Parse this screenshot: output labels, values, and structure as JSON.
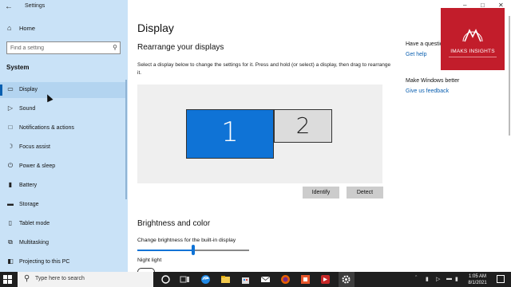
{
  "window": {
    "app_title": "Settings"
  },
  "sidebar": {
    "home_label": "Home",
    "search_placeholder": "Find a setting",
    "section_label": "System",
    "items": [
      {
        "label": "Display",
        "icon": "monitor-icon",
        "selected": true
      },
      {
        "label": "Sound",
        "icon": "speaker-icon"
      },
      {
        "label": "Notifications & actions",
        "icon": "notification-icon"
      },
      {
        "label": "Focus assist",
        "icon": "moon-icon"
      },
      {
        "label": "Power & sleep",
        "icon": "power-icon"
      },
      {
        "label": "Battery",
        "icon": "battery-icon"
      },
      {
        "label": "Storage",
        "icon": "storage-icon"
      },
      {
        "label": "Tablet mode",
        "icon": "tablet-icon"
      },
      {
        "label": "Multitasking",
        "icon": "multitasking-icon"
      },
      {
        "label": "Projecting to this PC",
        "icon": "projecting-icon"
      }
    ]
  },
  "main": {
    "page_title": "Display",
    "section_title": "Rearrange your displays",
    "description": "Select a display below to change the settings for it. Press and hold (or select) a display, then drag to rearrange it.",
    "monitors": [
      {
        "number": "1",
        "selected": true
      },
      {
        "number": "2",
        "selected": false
      }
    ],
    "identify_label": "Identify",
    "detect_label": "Detect",
    "brightness_title": "Brightness and color",
    "brightness_label": "Change brightness for the built-in display",
    "brightness_value_pct": 50,
    "night_light_label": "Night light"
  },
  "right_panel": {
    "question": "Have a questio",
    "get_help": "Get help",
    "better_title": "Make Windows better",
    "feedback": "Give us feedback"
  },
  "logo": {
    "brand": "IMAKS INSIGHTS"
  },
  "taskbar": {
    "search_placeholder": "Type here to search",
    "time": "1:05 AM",
    "date": "8/1/2021"
  },
  "colors": {
    "accent": "#0f73d6",
    "sidebar_bg": "#c9e2f7",
    "logo_bg": "#c21d2b",
    "taskbar_bg": "#1f1f1f"
  }
}
